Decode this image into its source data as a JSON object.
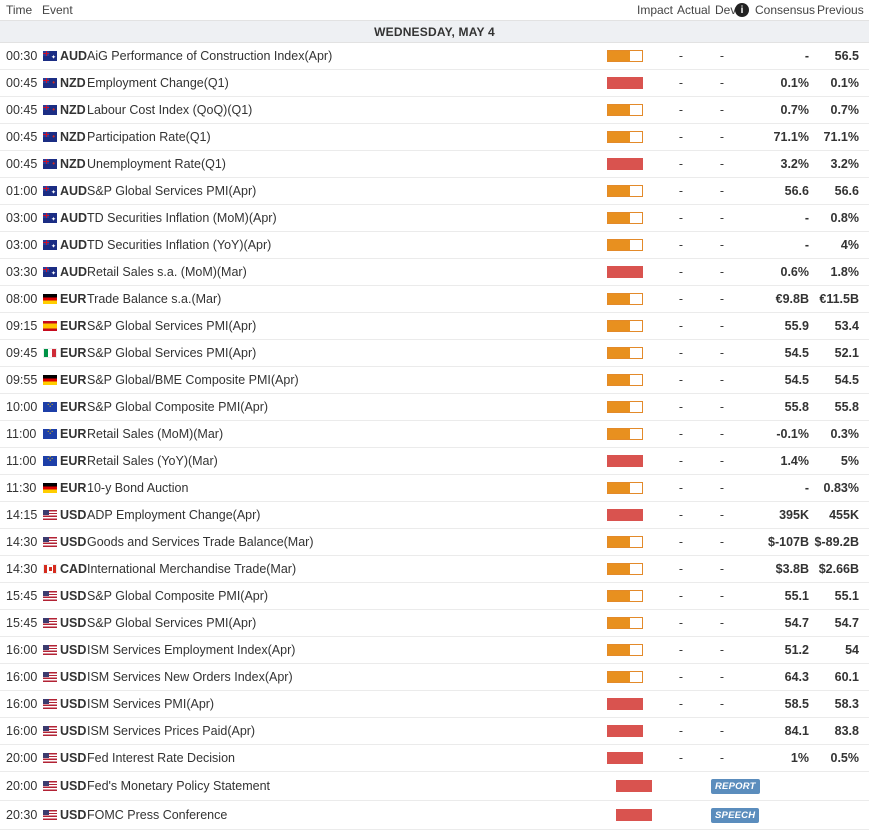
{
  "header": {
    "time": "Time",
    "event": "Event",
    "impact": "Impact",
    "actual": "Actual",
    "dev": "Dev",
    "info_icon": "info-icon",
    "consensus": "Consensus",
    "previous": "Previous"
  },
  "day": "WEDNESDAY, MAY 4",
  "impact_colors": {
    "medium": "#e8901f",
    "high": "#d9534f"
  },
  "tag_color": "#5b8dbd",
  "events": [
    {
      "time": "00:30",
      "flag": "aud",
      "currency": "AUD",
      "event": "AiG Performance of Construction Index(Apr)",
      "impact": "medium",
      "actual": "-",
      "dev": "-",
      "consensus": "-",
      "previous": "56.5"
    },
    {
      "time": "00:45",
      "flag": "nzd",
      "currency": "NZD",
      "event": "Employment Change(Q1)",
      "impact": "high",
      "actual": "-",
      "dev": "-",
      "consensus": "0.1%",
      "previous": "0.1%"
    },
    {
      "time": "00:45",
      "flag": "nzd",
      "currency": "NZD",
      "event": "Labour Cost Index (QoQ)(Q1)",
      "impact": "medium",
      "actual": "-",
      "dev": "-",
      "consensus": "0.7%",
      "previous": "0.7%"
    },
    {
      "time": "00:45",
      "flag": "nzd",
      "currency": "NZD",
      "event": "Participation Rate(Q1)",
      "impact": "medium",
      "actual": "-",
      "dev": "-",
      "consensus": "71.1%",
      "previous": "71.1%"
    },
    {
      "time": "00:45",
      "flag": "nzd",
      "currency": "NZD",
      "event": "Unemployment Rate(Q1)",
      "impact": "high",
      "actual": "-",
      "dev": "-",
      "consensus": "3.2%",
      "previous": "3.2%"
    },
    {
      "time": "01:00",
      "flag": "aud",
      "currency": "AUD",
      "event": "S&P Global Services PMI(Apr)",
      "impact": "medium",
      "actual": "-",
      "dev": "-",
      "consensus": "56.6",
      "previous": "56.6"
    },
    {
      "time": "03:00",
      "flag": "aud",
      "currency": "AUD",
      "event": "TD Securities Inflation (MoM)(Apr)",
      "impact": "medium",
      "actual": "-",
      "dev": "-",
      "consensus": "-",
      "previous": "0.8%"
    },
    {
      "time": "03:00",
      "flag": "aud",
      "currency": "AUD",
      "event": "TD Securities Inflation (YoY)(Apr)",
      "impact": "medium",
      "actual": "-",
      "dev": "-",
      "consensus": "-",
      "previous": "4%"
    },
    {
      "time": "03:30",
      "flag": "aud",
      "currency": "AUD",
      "event": "Retail Sales s.a. (MoM)(Mar)",
      "impact": "high",
      "actual": "-",
      "dev": "-",
      "consensus": "0.6%",
      "previous": "1.8%"
    },
    {
      "time": "08:00",
      "flag": "de",
      "currency": "EUR",
      "event": "Trade Balance s.a.(Mar)",
      "impact": "medium",
      "actual": "-",
      "dev": "-",
      "consensus": "€9.8B",
      "previous": "€11.5B"
    },
    {
      "time": "09:15",
      "flag": "es",
      "currency": "EUR",
      "event": "S&P Global Services PMI(Apr)",
      "impact": "medium",
      "actual": "-",
      "dev": "-",
      "consensus": "55.9",
      "previous": "53.4"
    },
    {
      "time": "09:45",
      "flag": "it",
      "currency": "EUR",
      "event": "S&P Global Services PMI(Apr)",
      "impact": "medium",
      "actual": "-",
      "dev": "-",
      "consensus": "54.5",
      "previous": "52.1"
    },
    {
      "time": "09:55",
      "flag": "de",
      "currency": "EUR",
      "event": "S&P Global/BME Composite PMI(Apr)",
      "impact": "medium",
      "actual": "-",
      "dev": "-",
      "consensus": "54.5",
      "previous": "54.5"
    },
    {
      "time": "10:00",
      "flag": "eu",
      "currency": "EUR",
      "event": "S&P Global Composite PMI(Apr)",
      "impact": "medium",
      "actual": "-",
      "dev": "-",
      "consensus": "55.8",
      "previous": "55.8"
    },
    {
      "time": "11:00",
      "flag": "eu",
      "currency": "EUR",
      "event": "Retail Sales (MoM)(Mar)",
      "impact": "medium",
      "actual": "-",
      "dev": "-",
      "consensus": "-0.1%",
      "previous": "0.3%"
    },
    {
      "time": "11:00",
      "flag": "eu",
      "currency": "EUR",
      "event": "Retail Sales (YoY)(Mar)",
      "impact": "high",
      "actual": "-",
      "dev": "-",
      "consensus": "1.4%",
      "previous": "5%"
    },
    {
      "time": "11:30",
      "flag": "de",
      "currency": "EUR",
      "event": "10-y Bond Auction",
      "impact": "medium",
      "actual": "-",
      "dev": "-",
      "consensus": "-",
      "previous": "0.83%"
    },
    {
      "time": "14:15",
      "flag": "us",
      "currency": "USD",
      "event": "ADP Employment Change(Apr)",
      "impact": "high",
      "actual": "-",
      "dev": "-",
      "consensus": "395K",
      "previous": "455K"
    },
    {
      "time": "14:30",
      "flag": "us",
      "currency": "USD",
      "event": "Goods and Services Trade Balance(Mar)",
      "impact": "medium",
      "actual": "-",
      "dev": "-",
      "consensus": "$-107B",
      "previous": "$-89.2B"
    },
    {
      "time": "14:30",
      "flag": "ca",
      "currency": "CAD",
      "event": "International Merchandise Trade(Mar)",
      "impact": "medium",
      "actual": "-",
      "dev": "-",
      "consensus": "$3.8B",
      "previous": "$2.66B"
    },
    {
      "time": "15:45",
      "flag": "us",
      "currency": "USD",
      "event": "S&P Global Composite PMI(Apr)",
      "impact": "medium",
      "actual": "-",
      "dev": "-",
      "consensus": "55.1",
      "previous": "55.1"
    },
    {
      "time": "15:45",
      "flag": "us",
      "currency": "USD",
      "event": "S&P Global Services PMI(Apr)",
      "impact": "medium",
      "actual": "-",
      "dev": "-",
      "consensus": "54.7",
      "previous": "54.7"
    },
    {
      "time": "16:00",
      "flag": "us",
      "currency": "USD",
      "event": "ISM Services Employment Index(Apr)",
      "impact": "medium",
      "actual": "-",
      "dev": "-",
      "consensus": "51.2",
      "previous": "54"
    },
    {
      "time": "16:00",
      "flag": "us",
      "currency": "USD",
      "event": "ISM Services New Orders Index(Apr)",
      "impact": "medium",
      "actual": "-",
      "dev": "-",
      "consensus": "64.3",
      "previous": "60.1"
    },
    {
      "time": "16:00",
      "flag": "us",
      "currency": "USD",
      "event": "ISM Services PMI(Apr)",
      "impact": "high",
      "actual": "-",
      "dev": "-",
      "consensus": "58.5",
      "previous": "58.3"
    },
    {
      "time": "16:00",
      "flag": "us",
      "currency": "USD",
      "event": "ISM Services Prices Paid(Apr)",
      "impact": "high",
      "actual": "-",
      "dev": "-",
      "consensus": "84.1",
      "previous": "83.8"
    },
    {
      "time": "20:00",
      "flag": "us",
      "currency": "USD",
      "event": "Fed Interest Rate Decision",
      "impact": "high",
      "actual": "-",
      "dev": "-",
      "consensus": "1%",
      "previous": "0.5%"
    },
    {
      "time": "20:00",
      "flag": "us",
      "currency": "USD",
      "event": "Fed's Monetary Policy Statement",
      "impact": "high",
      "tag": "REPORT"
    },
    {
      "time": "20:30",
      "flag": "us",
      "currency": "USD",
      "event": "FOMC Press Conference",
      "impact": "high",
      "tag": "SPEECH"
    }
  ]
}
